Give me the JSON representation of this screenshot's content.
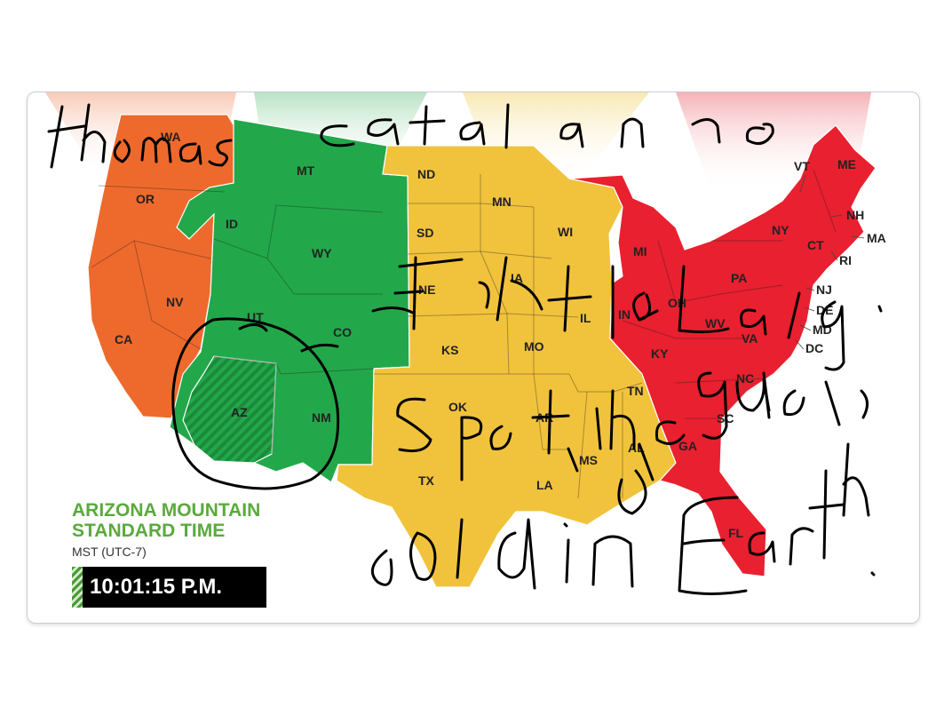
{
  "states": {
    "WA": "WA",
    "OR": "OR",
    "CA": "CA",
    "NV": "NV",
    "ID": "ID",
    "MT": "MT",
    "WY": "WY",
    "UT": "UT",
    "CO": "CO",
    "AZ": "AZ",
    "NM": "NM",
    "ND": "ND",
    "SD": "SD",
    "NE": "NE",
    "KS": "KS",
    "OK": "OK",
    "TX": "TX",
    "MN": "MN",
    "IA": "IA",
    "MO": "MO",
    "AR": "AR",
    "LA": "LA",
    "WI": "WI",
    "IL": "IL",
    "MS": "MS",
    "AL": "AL",
    "TN": "TN",
    "MI": "MI",
    "IN": "IN",
    "OH": "OH",
    "KY": "KY",
    "WV": "WV",
    "VA": "VA",
    "PA": "PA",
    "NY": "NY",
    "VT": "VT",
    "ME": "ME",
    "NH": "NH",
    "MA": "MA",
    "CT": "CT",
    "RI": "RI",
    "NJ": "NJ",
    "DE": "DE",
    "MD": "MD",
    "DC": "DC",
    "NC": "NC",
    "SC": "SC",
    "GA": "GA",
    "FL": "FL"
  },
  "zones": {
    "pacific_color": "#ee6a2c",
    "mountain_color": "#22a84a",
    "central_color": "#f1c33c",
    "eastern_color": "#e8202f"
  },
  "legend": {
    "title_line1": "ARIZONA MOUNTAIN",
    "title_line2": "STANDARD TIME",
    "subtitle": "MST (UTC-7)",
    "time": "10:01:15 P.M."
  },
  "handwriting": {
    "line1": "thomas catalano",
    "line2": "first Lady",
    "line3": "Spot the gold",
    "line4": "gold in Earth",
    "color": "#000000"
  }
}
